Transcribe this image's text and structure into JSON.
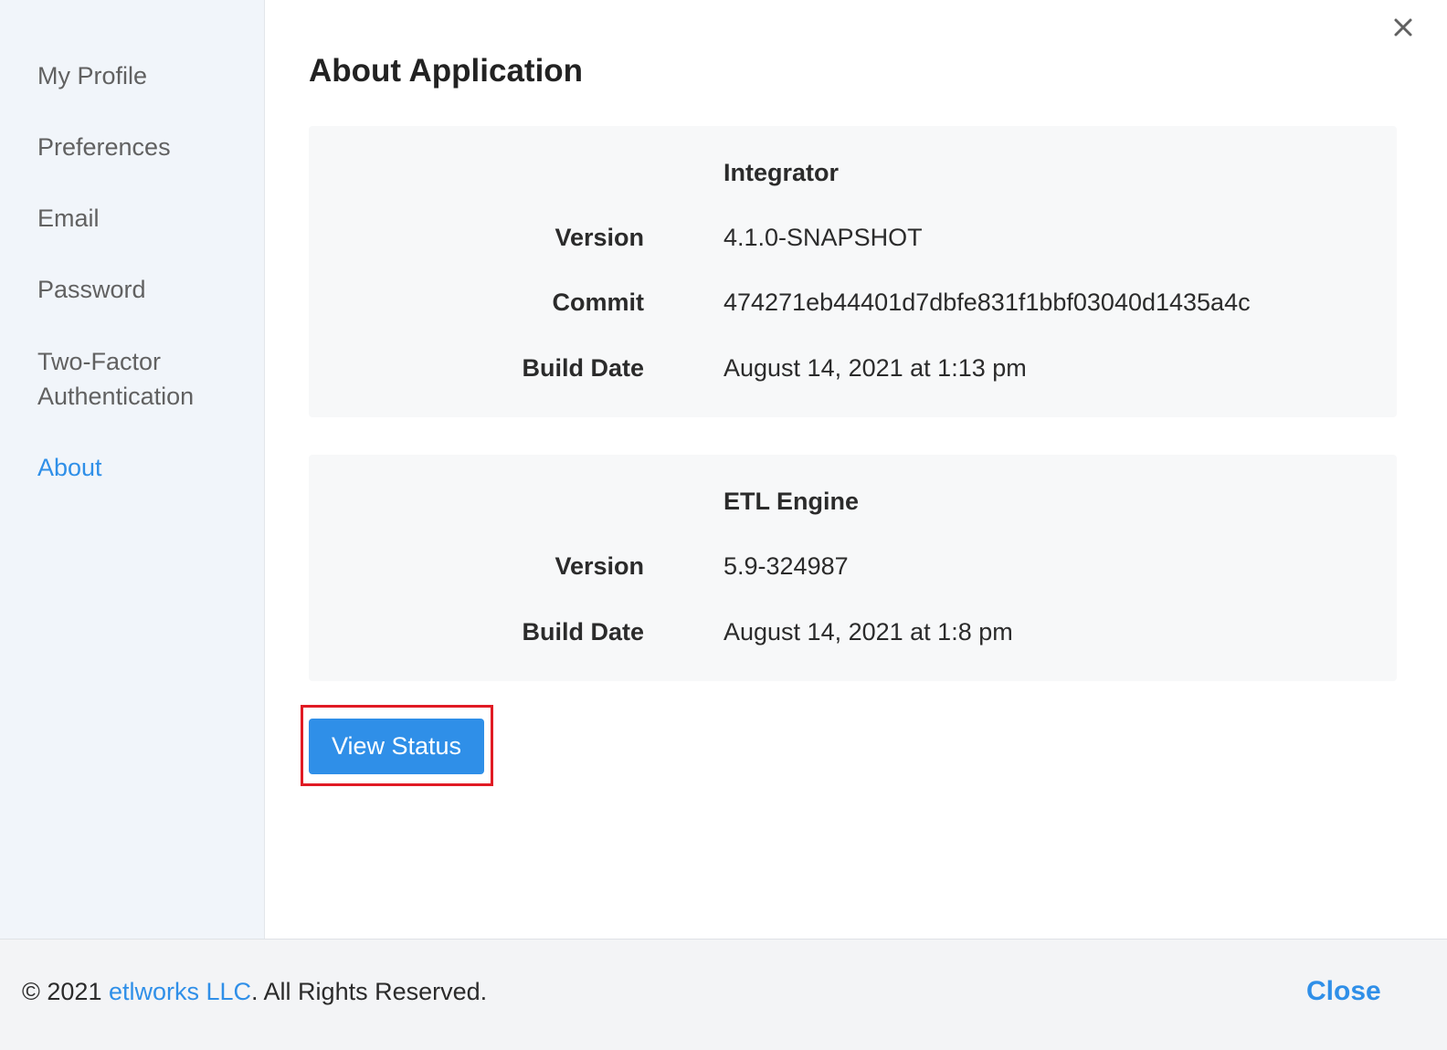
{
  "sidebar": {
    "items": [
      {
        "label": "My Profile"
      },
      {
        "label": "Preferences"
      },
      {
        "label": "Email"
      },
      {
        "label": "Password"
      },
      {
        "label": "Two-Factor Authentication"
      },
      {
        "label": "About"
      }
    ],
    "active": "About"
  },
  "main": {
    "title": "About Application",
    "integrator": {
      "title": "Integrator",
      "rows": [
        {
          "label": "Version",
          "value": "4.1.0-SNAPSHOT"
        },
        {
          "label": "Commit",
          "value": "474271eb44401d7dbfe831f1bbf03040d1435a4c"
        },
        {
          "label": "Build Date",
          "value": "August 14, 2021 at 1:13 pm"
        }
      ]
    },
    "etl_engine": {
      "title": "ETL Engine",
      "rows": [
        {
          "label": "Version",
          "value": "5.9-324987"
        },
        {
          "label": "Build Date",
          "value": "August 14, 2021 at 1:8 pm"
        }
      ]
    },
    "view_status_label": "View Status",
    "highlight_color": "#e01b24"
  },
  "footer": {
    "copyright_prefix": "© 2021 ",
    "company_link": "etlworks LLC",
    "copyright_suffix": ". All Rights Reserved.",
    "close_label": "Close"
  },
  "colors": {
    "accent": "#2f8fe8",
    "sidebar_bg": "#f1f5fa",
    "card_bg": "#f7f8f9"
  },
  "icons": {
    "close": "close-icon"
  }
}
